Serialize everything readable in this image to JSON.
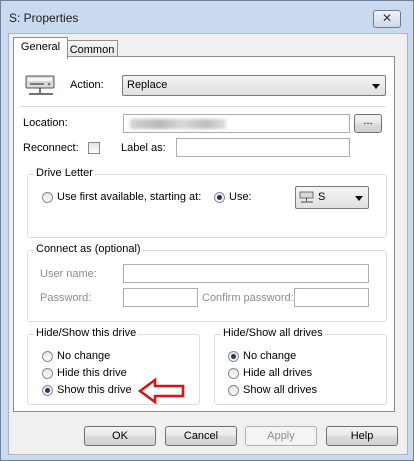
{
  "window": {
    "title": "S: Properties",
    "close_label": "✕"
  },
  "tabs": [
    {
      "label": "General"
    },
    {
      "label": "Common"
    }
  ],
  "action": {
    "label": "Action:",
    "value": "Replace"
  },
  "location": {
    "label": "Location:",
    "browse_label": "..."
  },
  "reconnect": {
    "label": "Reconnect:",
    "label_as": "Label as:"
  },
  "drive_letter": {
    "title": "Drive Letter",
    "first_available": "Use first available, starting at:",
    "use": "Use:",
    "value": "S"
  },
  "connect_as": {
    "title": "Connect as (optional)",
    "user_name": "User name:",
    "password": "Password:",
    "confirm_password": "Confirm password:"
  },
  "hide_show_this": {
    "title": "Hide/Show this drive",
    "options": [
      "No change",
      "Hide this drive",
      "Show this drive"
    ]
  },
  "hide_show_all": {
    "title": "Hide/Show all drives",
    "options": [
      "No change",
      "Hide all drives",
      "Show all drives"
    ]
  },
  "buttons": {
    "ok": "OK",
    "cancel": "Cancel",
    "apply": "Apply",
    "help": "Help"
  },
  "colors": {
    "annotation_arrow": "#d9141b",
    "title_bar": "#c9daf0",
    "selected_radio": "#1a3a66"
  }
}
